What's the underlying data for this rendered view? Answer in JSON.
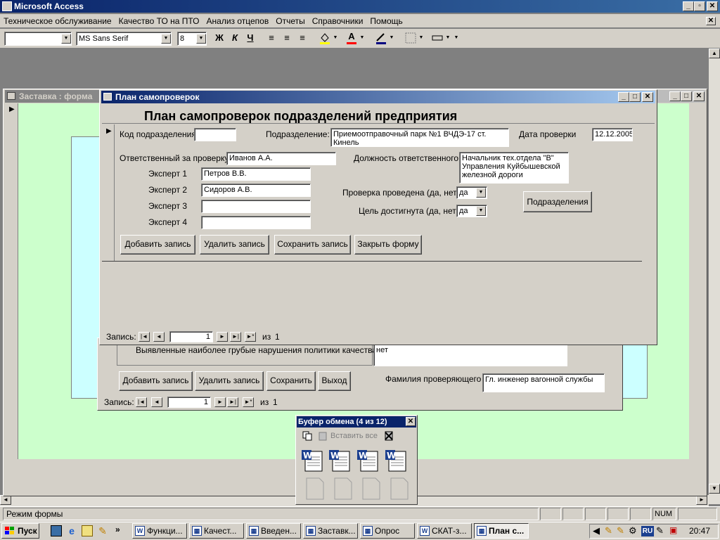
{
  "app": {
    "title": "Microsoft Access"
  },
  "menu": [
    "Техническое обслуживание",
    "Качество ТО на ПТО",
    "Анализ отцепов",
    "Отчеты",
    "Справочники",
    "Помощь"
  ],
  "toolbar": {
    "font_name": "MS Sans Serif",
    "font_size": "8",
    "bold": "Ж",
    "italic": "К",
    "underline": "Ч"
  },
  "back_window": {
    "title": "Заставка : форма",
    "violations_label": "Выявленные наиболее грубые нарушения политики качества",
    "violations_value": "нет",
    "inspector_label": "Фамилия проверяющего",
    "inspector_value": "Гл. инженер вагонной службы",
    "buttons": {
      "add": "Добавить запись",
      "delete": "Удалить запись",
      "save": "Сохранить",
      "exit": "Выход"
    },
    "nav": {
      "label": "Запись:",
      "current": "1",
      "of": "из",
      "total": "1"
    }
  },
  "form": {
    "title": "План самопроверок",
    "heading": "План самопроверок подразделений предприятия",
    "division_code_label": "Код подразделения",
    "division_code_value": "",
    "division_label": "Подразделение:",
    "division_value": "Приемоотправочный парк №1 ВЧДЭ-17 ст. Кинель",
    "check_date_label": "Дата проверки",
    "check_date_value": "12.12.2005",
    "responsible_label": "Ответственный за проверку",
    "responsible_value": "Иванов А.А.",
    "position_label": "Должность ответственного",
    "position_value": "Начальник тех.отдела \"В\" Управления Куйбышевской железной дороги",
    "experts": [
      {
        "label": "Эксперт 1",
        "value": "Петров В.В."
      },
      {
        "label": "Эксперт 2",
        "value": "Сидоров А.В."
      },
      {
        "label": "Эксперт 3",
        "value": ""
      },
      {
        "label": "Эксперт 4",
        "value": ""
      }
    ],
    "check_done_label": "Проверка проведена (да, нет)",
    "check_done_value": "да",
    "goal_label": "Цель достигнута (да, нет)",
    "goal_value": "да",
    "divisions_button": "Подразделения",
    "buttons": {
      "add": "Добавить запись",
      "delete": "Удалить запись",
      "save": "Сохранить запись",
      "close": "Закрыть форму"
    },
    "nav": {
      "label": "Запись:",
      "current": "1",
      "of": "из",
      "total": "1"
    }
  },
  "clipboard": {
    "title": "Буфер обмена (4 из 12)",
    "paste_all": "Вставить все"
  },
  "status": {
    "mode": "Режим формы",
    "num": "NUM"
  },
  "taskbar": {
    "start": "Пуск",
    "items": [
      "Функци...",
      "Качест...",
      "Введен...",
      "Заставк...",
      "Опрос",
      "СКАТ-з...",
      "План с..."
    ],
    "lang": "RU",
    "clock": "20:47"
  },
  "colors": {
    "title_active": "#0a246a",
    "face": "#d4d0c8",
    "workspace": "#808080",
    "form_bg": "#ccffcc"
  }
}
